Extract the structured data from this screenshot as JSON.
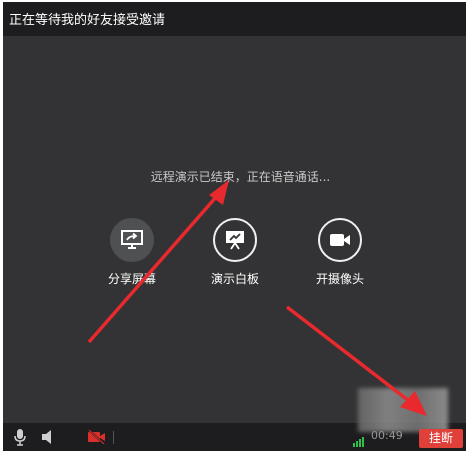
{
  "window": {
    "title": "正在等待我的好友接受邀请"
  },
  "status": {
    "text": "远程演示已结束，正在语音通话..."
  },
  "actions": [
    {
      "label": "分享屏幕",
      "icon": "share-screen-icon"
    },
    {
      "label": "演示白板",
      "icon": "whiteboard-icon"
    },
    {
      "label": "开摄像头",
      "icon": "camera-icon"
    }
  ],
  "bottom": {
    "timer": "00:49",
    "hangup_label": "挂断"
  },
  "colors": {
    "background": "#333335",
    "bar": "#1d1d1f",
    "hangup": "#e0403a",
    "arrow": "#e8292e",
    "camera_off": "#d9302c",
    "signal": "#2fbf4a"
  }
}
